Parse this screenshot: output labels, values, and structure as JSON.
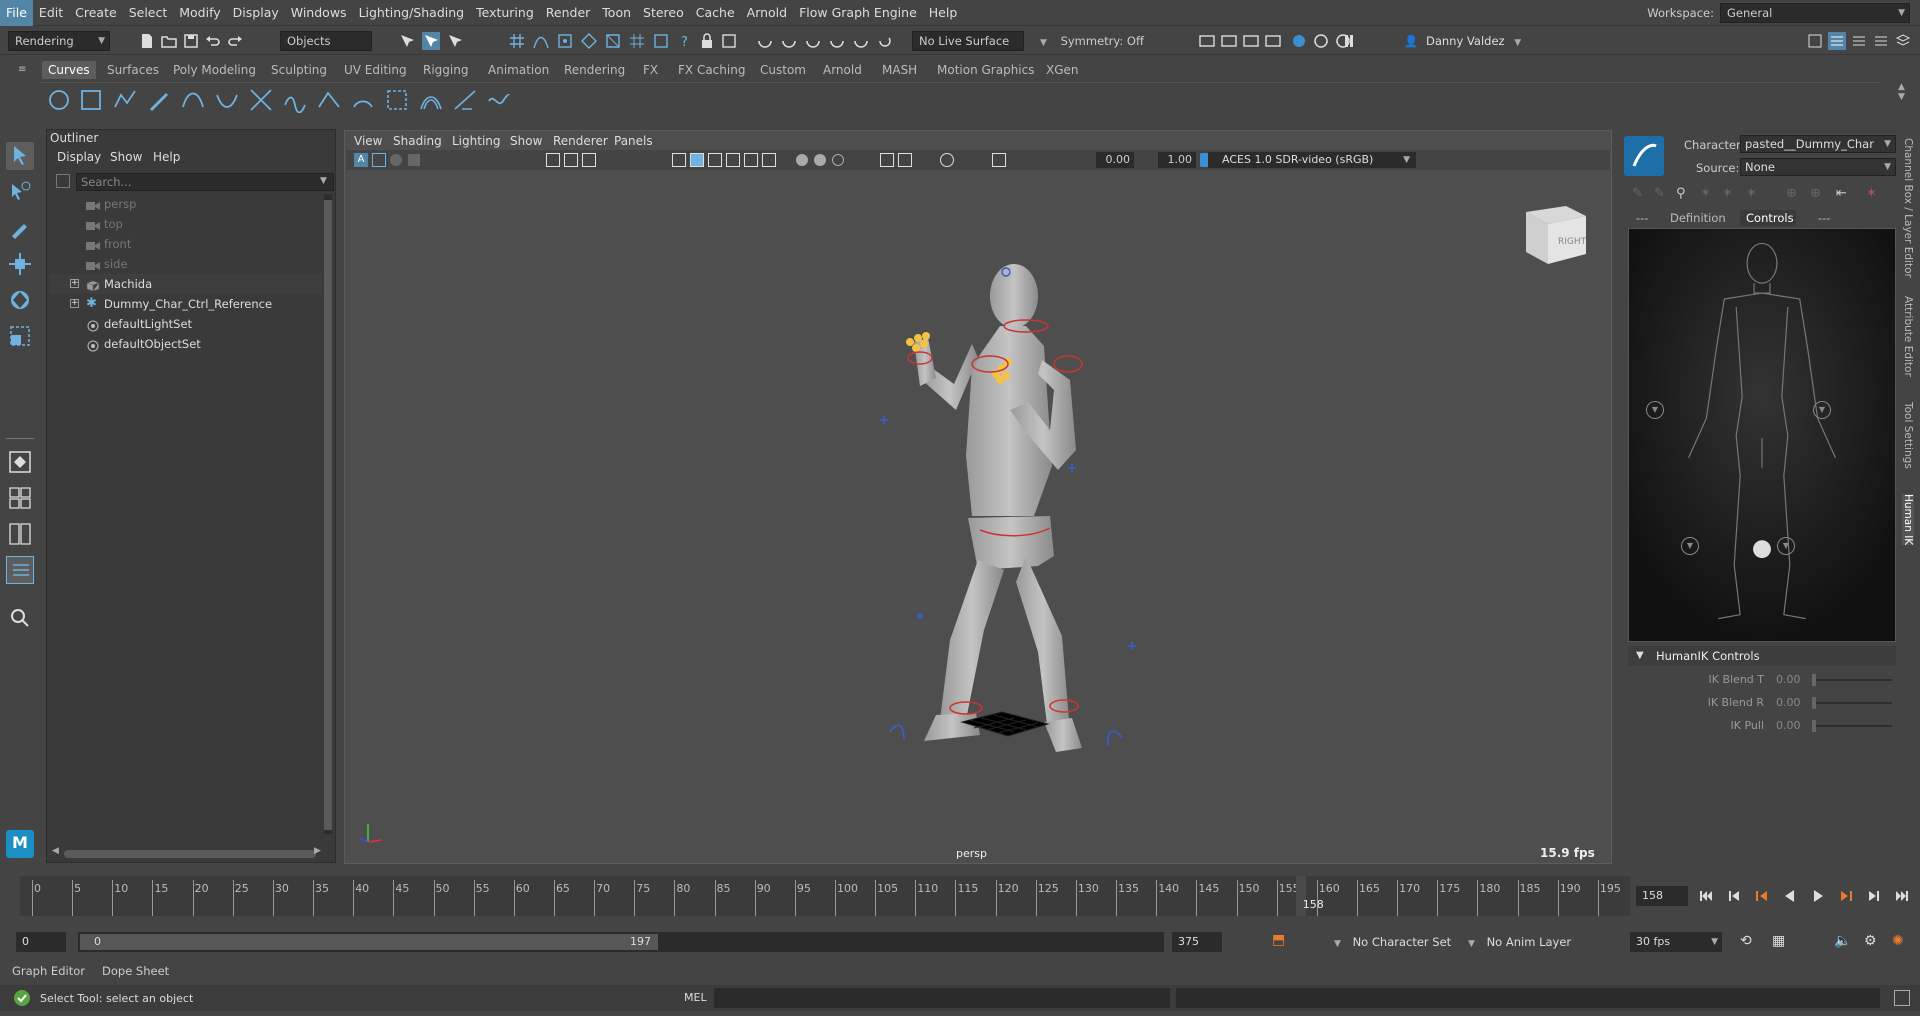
{
  "menubar": {
    "items": [
      "File",
      "Edit",
      "Create",
      "Select",
      "Modify",
      "Display",
      "Windows",
      "Lighting/Shading",
      "Texturing",
      "Render",
      "Toon",
      "Stereo",
      "Cache",
      "Arnold",
      "Flow Graph Engine",
      "Help"
    ],
    "workspace_label": "Workspace:",
    "workspace_value": "General"
  },
  "statusline": {
    "menuset": "Rendering",
    "selmode": "Objects",
    "live_surface": "No Live Surface",
    "symmetry": "Symmetry: Off",
    "user": "Danny Valdez"
  },
  "shelf": {
    "tabs": [
      "Curves",
      "Surfaces",
      "Poly Modeling",
      "Sculpting",
      "UV Editing",
      "Rigging",
      "Animation",
      "Rendering",
      "FX",
      "FX Caching",
      "Custom",
      "Arnold",
      "MASH",
      "Motion Graphics",
      "XGen"
    ],
    "active_tab": "Curves"
  },
  "outliner": {
    "title": "Outliner",
    "menus": [
      "Display",
      "Show",
      "Help"
    ],
    "search_placeholder": "Search...",
    "items": [
      {
        "label": "persp",
        "type": "camera",
        "dim": true
      },
      {
        "label": "top",
        "type": "camera",
        "dim": true
      },
      {
        "label": "front",
        "type": "camera",
        "dim": true
      },
      {
        "label": "side",
        "type": "camera",
        "dim": true
      },
      {
        "label": "Machida",
        "type": "group",
        "dim": false
      },
      {
        "label": "Dummy_Char_Ctrl_Reference",
        "type": "reference",
        "dim": false
      },
      {
        "label": "defaultLightSet",
        "type": "set",
        "dim": false
      },
      {
        "label": "defaultObjectSet",
        "type": "set",
        "dim": false
      }
    ]
  },
  "viewport": {
    "menus": [
      "View",
      "Shading",
      "Lighting",
      "Show",
      "Renderer",
      "Panels"
    ],
    "value1": "0.00",
    "value2": "1.00",
    "colorspace": "ACES 1.0 SDR-video (sRGB)",
    "camera": "persp",
    "fps": "15.9 fps",
    "viewcube_label": "RIGHT"
  },
  "humanik": {
    "character_label": "Character:",
    "character_value": "pasted__Dummy_Char",
    "source_label": "Source:",
    "source_value": "None",
    "tabs": [
      "---",
      "Definition",
      "Controls",
      "---"
    ],
    "active_tab": "Controls",
    "controls_title": "HumanIK Controls",
    "sliders": [
      {
        "name": "IK Blend T",
        "value": "0.00"
      },
      {
        "name": "IK Blend R",
        "value": "0.00"
      },
      {
        "name": "IK Pull",
        "value": "0.00"
      }
    ]
  },
  "sidetabs": [
    "Channel Box / Layer Editor",
    "Attribute Editor",
    "Tool Settings",
    "Human IK"
  ],
  "timeline": {
    "ticks": [
      "0",
      "5",
      "10",
      "15",
      "20",
      "25",
      "30",
      "35",
      "40",
      "45",
      "50",
      "55",
      "60",
      "65",
      "70",
      "75",
      "80",
      "85",
      "90",
      "95",
      "100",
      "105",
      "110",
      "115",
      "120",
      "125",
      "130",
      "135",
      "140",
      "145",
      "150",
      "155",
      "160",
      "165",
      "170",
      "175",
      "180",
      "185",
      "190",
      "195"
    ],
    "current_frame": "158",
    "current_field": "158"
  },
  "range": {
    "scene_start": "0",
    "range_start": "0",
    "range_end": "197",
    "scene_end": "375",
    "character_set": "No Character Set",
    "anim_layer": "No Anim Layer",
    "fps": "30 fps"
  },
  "bottom_tabs": [
    "Graph Editor",
    "Dope Sheet"
  ],
  "commandline": {
    "help": "Select Tool: select an object",
    "lang": "MEL"
  }
}
